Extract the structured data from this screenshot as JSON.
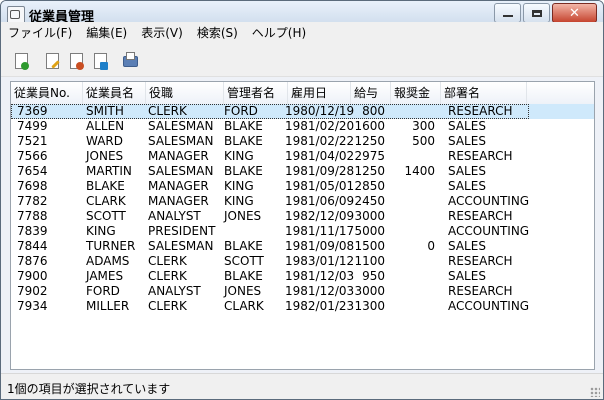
{
  "window": {
    "title": "従業員管理"
  },
  "menu": {
    "items": [
      "ファイル(F)",
      "編集(E)",
      "表示(V)",
      "検索(S)",
      "ヘルプ(H)"
    ]
  },
  "toolbar": {
    "buttons": [
      {
        "icon": "new-doc-icon",
        "color": "#2e9a2e"
      },
      {
        "icon": "edit-doc-icon",
        "color": "#e0a317"
      },
      {
        "icon": "delete-doc-icon",
        "color": "#c94e22"
      },
      {
        "icon": "export-doc-icon",
        "color": "#1e7fc9"
      },
      {
        "icon": "print-icon",
        "color": "#4a74b0"
      }
    ]
  },
  "table": {
    "headers": [
      "従業員No.",
      "従業員名",
      "役職",
      "管理者名",
      "雇用日",
      "給与",
      "報奨金",
      "部署名"
    ],
    "rows": [
      [
        "7369",
        "SMITH",
        "CLERK",
        "FORD",
        "1980/12/19",
        "800",
        "",
        "RESEARCH"
      ],
      [
        "7499",
        "ALLEN",
        "SALESMAN",
        "BLAKE",
        "1981/02/20",
        "1600",
        "300",
        "SALES"
      ],
      [
        "7521",
        "WARD",
        "SALESMAN",
        "BLAKE",
        "1981/02/22",
        "1250",
        "500",
        "SALES"
      ],
      [
        "7566",
        "JONES",
        "MANAGER",
        "KING",
        "1981/04/02",
        "2975",
        "",
        "RESEARCH"
      ],
      [
        "7654",
        "MARTIN",
        "SALESMAN",
        "BLAKE",
        "1981/09/28",
        "1250",
        "1400",
        "SALES"
      ],
      [
        "7698",
        "BLAKE",
        "MANAGER",
        "KING",
        "1981/05/01",
        "2850",
        "",
        "SALES"
      ],
      [
        "7782",
        "CLARK",
        "MANAGER",
        "KING",
        "1981/06/09",
        "2450",
        "",
        "ACCOUNTING"
      ],
      [
        "7788",
        "SCOTT",
        "ANALYST",
        "JONES",
        "1982/12/09",
        "3000",
        "",
        "RESEARCH"
      ],
      [
        "7839",
        "KING",
        "PRESIDENT",
        "",
        "1981/11/17",
        "5000",
        "",
        "ACCOUNTING"
      ],
      [
        "7844",
        "TURNER",
        "SALESMAN",
        "BLAKE",
        "1981/09/08",
        "1500",
        "0",
        "SALES"
      ],
      [
        "7876",
        "ADAMS",
        "CLERK",
        "SCOTT",
        "1983/01/12",
        "1100",
        "",
        "RESEARCH"
      ],
      [
        "7900",
        "JAMES",
        "CLERK",
        "BLAKE",
        "1981/12/03",
        "950",
        "",
        "SALES"
      ],
      [
        "7902",
        "FORD",
        "ANALYST",
        "JONES",
        "1981/12/03",
        "3000",
        "",
        "RESEARCH"
      ],
      [
        "7934",
        "MILLER",
        "CLERK",
        "CLARK",
        "1982/01/23",
        "1300",
        "",
        "ACCOUNTING"
      ]
    ],
    "selected_index": 0,
    "selection_color": "#cfe9fb"
  },
  "status": {
    "text": "1個の項目が選択されています"
  }
}
